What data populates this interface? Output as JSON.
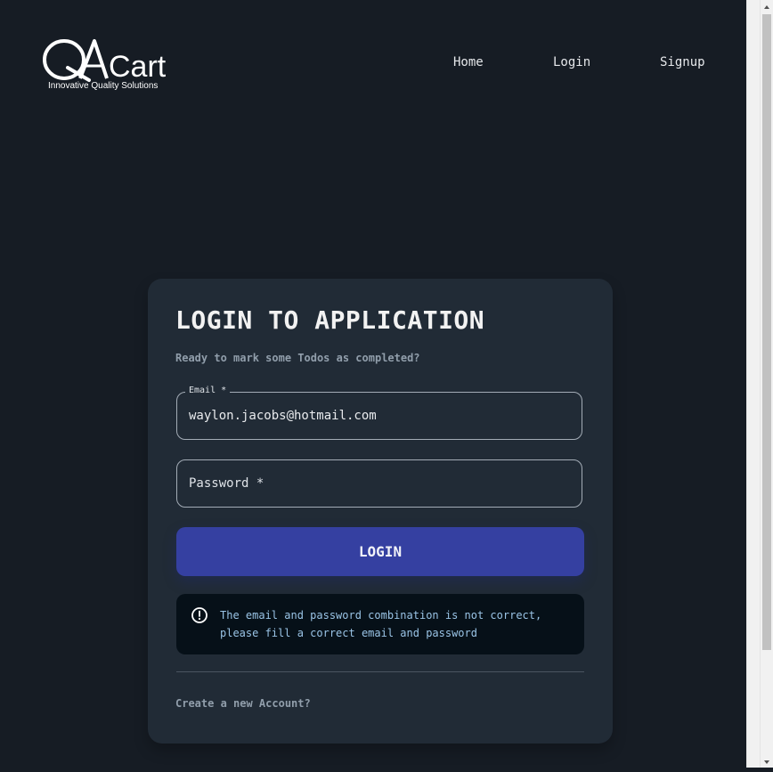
{
  "header": {
    "logo_text": "QACart",
    "logo_tagline": "Innovative Quality Solutions",
    "nav": [
      {
        "label": "Home"
      },
      {
        "label": "Login"
      },
      {
        "label": "Signup"
      }
    ]
  },
  "login_card": {
    "title": "LOGIN TO APPLICATION",
    "subtitle": "Ready to mark some Todos as completed?",
    "email": {
      "label": "Email *",
      "value": "waylon.jacobs@hotmail.com"
    },
    "password": {
      "label": "Password *",
      "value": ""
    },
    "submit_label": "LOGIN",
    "error": {
      "icon": "error-outline-icon",
      "message": "The email and password combination is not correct, please fill a correct email and password"
    },
    "create_account_link": "Create a new Account?"
  },
  "colors": {
    "background": "#161c24",
    "card": "#212b36",
    "primary": "#3540a1",
    "alert_bg": "#061018",
    "alert_text": "#9ac4e6"
  }
}
